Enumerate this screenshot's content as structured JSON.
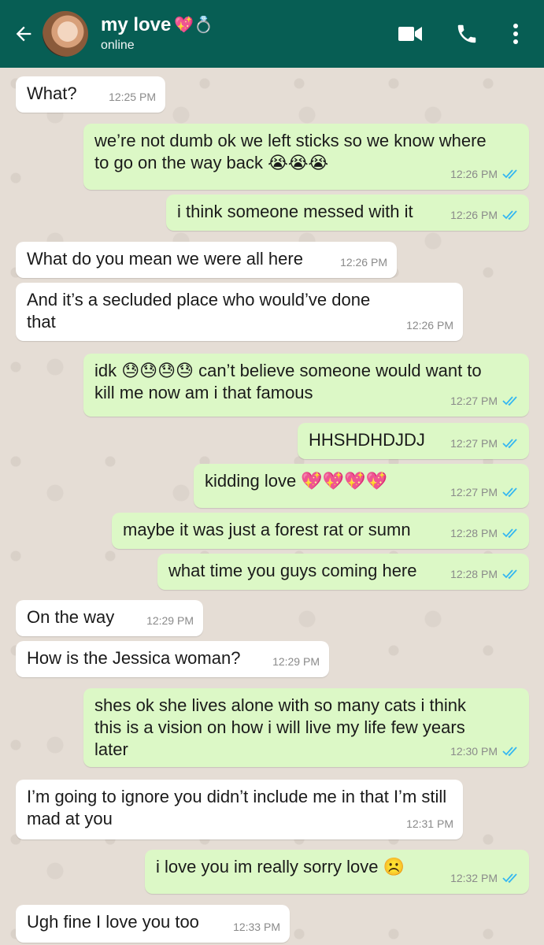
{
  "header": {
    "contact_name": "my love",
    "contact_emoji": "💖💍",
    "status": "online",
    "icons": [
      "back-arrow-icon",
      "video-call-icon",
      "phone-icon",
      "more-options-icon"
    ]
  },
  "colors": {
    "header": "#075e54",
    "outgoing": "#dcf8c6",
    "incoming": "#ffffff",
    "read_ticks": "#34b7f1"
  },
  "messages": [
    {
      "dir": "in",
      "text": "What?",
      "time": "12:25 PM"
    },
    {
      "dir": "out",
      "text": "we’re not dumb ok we left sticks so we know where to go on the way back 😭😭😭",
      "time": "12:26 PM"
    },
    {
      "dir": "out",
      "text": "i think someone messed with it",
      "time": "12:26 PM"
    },
    {
      "dir": "in",
      "text": "What do you mean we were all here",
      "time": "12:26 PM"
    },
    {
      "dir": "in",
      "text": "And it’s a secluded place who would’ve done that",
      "time": "12:26 PM"
    },
    {
      "dir": "out",
      "text": "idk 😓😓😓😓 can’t believe someone would want to kill me now am i that famous",
      "time": "12:27 PM"
    },
    {
      "dir": "out",
      "text": "HHSHDHDJDJ",
      "time": "12:27 PM"
    },
    {
      "dir": "out",
      "text": "kidding love 💖💖💖💖",
      "time": "12:27 PM"
    },
    {
      "dir": "out",
      "text": "maybe it was just a forest rat or sumn",
      "time": "12:28 PM"
    },
    {
      "dir": "out",
      "text": "what time you guys coming here",
      "time": "12:28 PM"
    },
    {
      "dir": "in",
      "text": "On the way",
      "time": "12:29 PM"
    },
    {
      "dir": "in",
      "text": "How is the Jessica woman?",
      "time": "12:29 PM"
    },
    {
      "dir": "out",
      "text": "shes ok she lives alone with so many cats i think this is a vision on how i will live my life few years later",
      "time": "12:30 PM"
    },
    {
      "dir": "in",
      "text": "I’m going to ignore you didn’t include me in that I’m still mad at you",
      "time": "12:31 PM"
    },
    {
      "dir": "out",
      "text": "i love you im really sorry love ☹️",
      "time": "12:32 PM"
    },
    {
      "dir": "in",
      "text": "Ugh fine I love you too",
      "time": "12:33 PM"
    }
  ]
}
